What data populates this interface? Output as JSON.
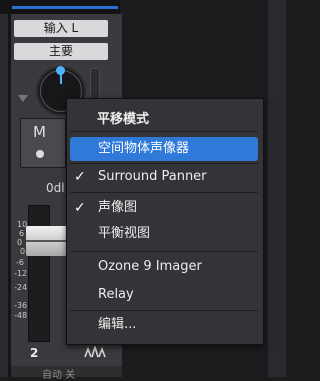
{
  "channel": {
    "input_button": "输入 L",
    "main_button": "主要",
    "mute_label": "M",
    "volume_readout": "0dl",
    "scale_ticks": [
      "10",
      "6",
      "0",
      "-6",
      "-12",
      "-24",
      "-36",
      "-48"
    ],
    "scale_first": "6",
    "number": "2",
    "automation": "自动 关"
  },
  "menu": {
    "title": "平移模式",
    "items": [
      {
        "label": "空间物体声像器",
        "checked": false,
        "highlighted": true
      },
      {
        "label": "Surround Panner",
        "checked": true,
        "highlighted": false
      },
      {
        "label": "声像图",
        "checked": true,
        "highlighted": false
      },
      {
        "label": "平衡视图",
        "checked": false,
        "highlighted": false
      },
      {
        "label": "Ozone 9 Imager",
        "checked": false,
        "highlighted": false
      },
      {
        "label": "Relay",
        "checked": false,
        "highlighted": false
      },
      {
        "label": "编辑...",
        "checked": false,
        "highlighted": false
      }
    ],
    "check_glyph": "✓"
  },
  "colors": {
    "highlight": "#2f7ad8",
    "knob_accent": "#4fb4ff",
    "menu_bg": "#343438"
  }
}
